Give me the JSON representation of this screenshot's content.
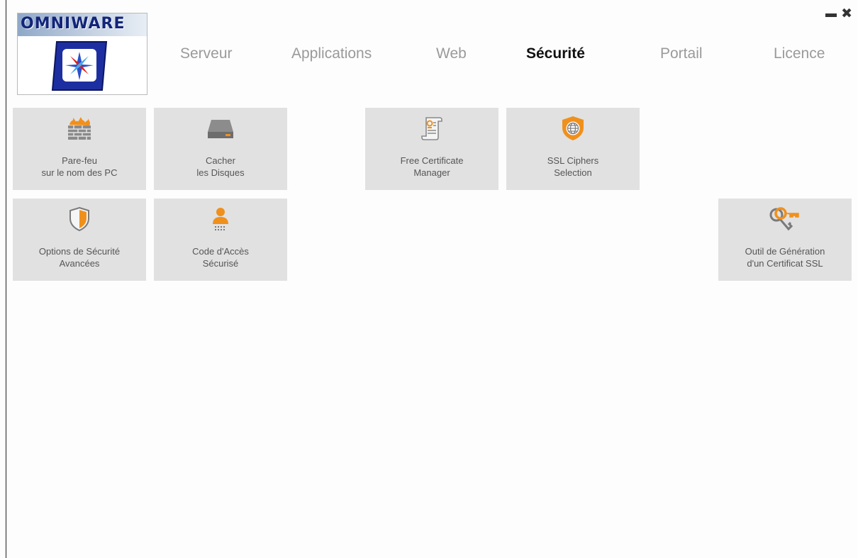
{
  "logo": {
    "text": "OMNIWARE"
  },
  "window_controls": {
    "minimize": "minimize",
    "close": "close"
  },
  "nav": {
    "tabs": [
      {
        "label": "Serveur"
      },
      {
        "label": "Applications"
      },
      {
        "label": "Web"
      },
      {
        "label": "Sécurité",
        "active": true
      },
      {
        "label": "Portail"
      },
      {
        "label": "Licence"
      }
    ]
  },
  "tiles": [
    {
      "label": "Pare-feu\nsur le nom des PC",
      "icon": "firewall-icon"
    },
    {
      "label": "Cacher\nles Disques",
      "icon": "hard-drive-icon"
    },
    {
      "label": "Free Certificate\nManager",
      "icon": "certificate-icon"
    },
    {
      "label": "SSL Ciphers\nSelection",
      "icon": "shield-globe-icon"
    },
    {
      "label": "Options de Sécurité\nAvancées",
      "icon": "shield-icon"
    },
    {
      "label": "Code d'Accès\nSécurisé",
      "icon": "user-keypad-icon"
    },
    {
      "label": "Outil de Génération\nd'un Certificat SSL",
      "icon": "keys-icon"
    }
  ],
  "colors": {
    "accent": "#f0901c",
    "tile": "#e1e1e1",
    "active_tab": "#111111",
    "inactive_tab": "#9a9a9a"
  }
}
